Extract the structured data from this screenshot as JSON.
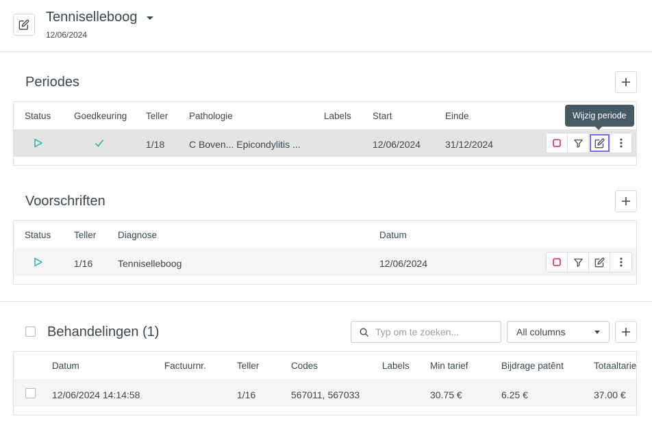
{
  "header": {
    "title": "Tenniselleboog",
    "date": "12/06/2024"
  },
  "periodes": {
    "title": "Periodes",
    "columns": [
      "Status",
      "Goedkeuring",
      "Teller",
      "Pathologie",
      "Labels",
      "Start",
      "Einde"
    ],
    "row": {
      "teller": "1/18",
      "pathologie": "C Boven... Epicondylitis ...",
      "labels": "",
      "start": "12/06/2024",
      "einde": "31/12/2024"
    },
    "tooltip": "Wijzig periode"
  },
  "voorschriften": {
    "title": "Voorschriften",
    "columns": [
      "Status",
      "Teller",
      "Diagnose",
      "Datum"
    ],
    "row": {
      "teller": "1/16",
      "diagnose": "Tenniselleboog",
      "datum": "12/06/2024"
    }
  },
  "behandelingen": {
    "title": "Behandelingen (1)",
    "search_placeholder": "Typ om te zoeken...",
    "filter_select": "All columns",
    "columns": [
      "Datum",
      "Factuurnr.",
      "Teller",
      "Codes",
      "Labels",
      "Min tarief",
      "Bijdrage patênt",
      "Totaaltarie"
    ],
    "row": {
      "datum": "12/06/2024 14:14:58",
      "factuurnr": "",
      "teller": "1/16",
      "codes": "567011, 567033",
      "labels": "",
      "min_tarief": "30.75 €",
      "bijdrage": "6.25 €",
      "totaal": "37.00 €"
    }
  },
  "colors": {
    "text": "#37474f",
    "status_play": "#26b5a0",
    "stop_icon": "#e91e63",
    "tooltip_bg": "#455a64",
    "focus": "#7b68ee"
  },
  "icons": [
    "edit-icon",
    "chevron-down-icon",
    "plus-icon",
    "play-icon",
    "check-icon",
    "stop-icon",
    "filter-icon",
    "more-vertical-icon",
    "search-icon"
  ]
}
